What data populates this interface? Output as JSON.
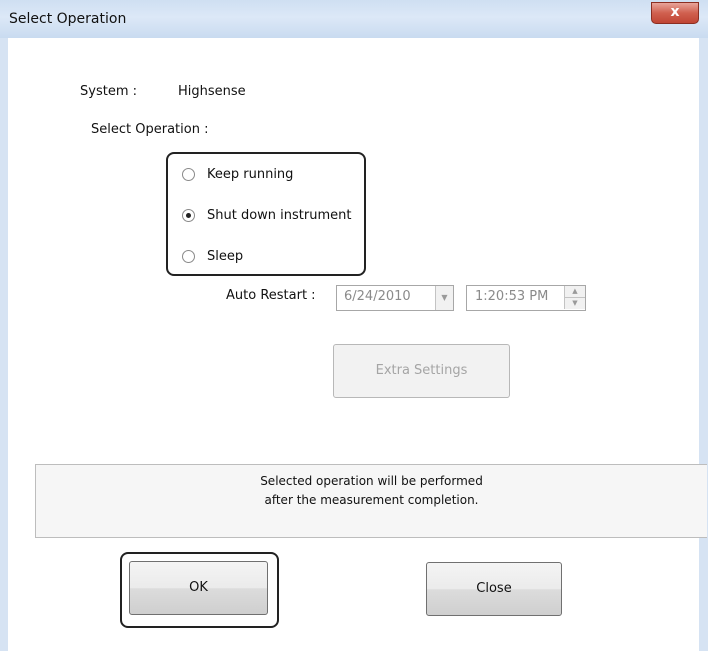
{
  "window": {
    "title": "Select Operation",
    "close_glyph": "x"
  },
  "form": {
    "system_label": "System :",
    "system_value": "Highsense",
    "select_operation_label": "Select Operation :"
  },
  "operations": [
    {
      "label": "Keep running",
      "checked": false
    },
    {
      "label": "Shut down instrument",
      "checked": true
    },
    {
      "label": "Sleep",
      "checked": false
    }
  ],
  "auto_restart": {
    "label": "Auto Restart :",
    "date": "6/24/2010",
    "time": "1:20:53 PM",
    "enabled": false
  },
  "buttons": {
    "extra_settings": "Extra Settings",
    "ok": "OK",
    "close": "Close"
  },
  "info": {
    "line1": "Selected operation will be performed",
    "line2": "after the measurement completion."
  }
}
